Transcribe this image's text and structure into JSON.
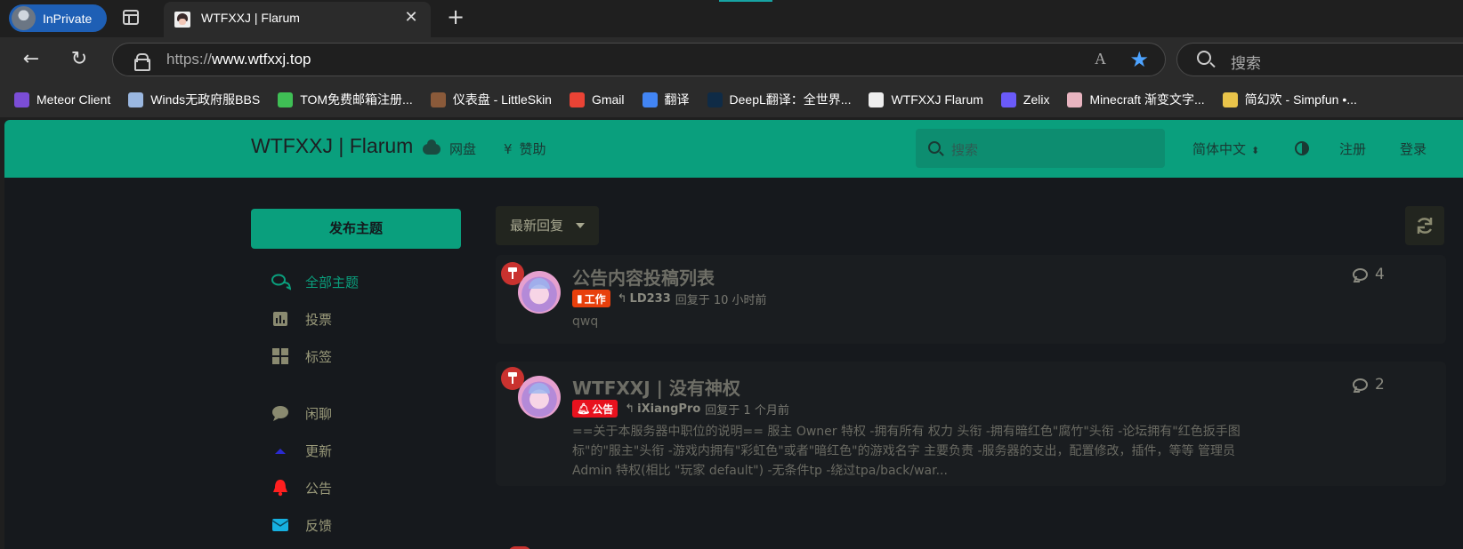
{
  "browser": {
    "inprivate_label": "InPrivate",
    "tab_title": "WTFXXJ | Flarum",
    "tab_close": "✕",
    "new_tab": "+",
    "url_prefix": "https://",
    "url_host": "www.wtfxxj.top",
    "search_placeholder": "搜索",
    "read_aloud": "A",
    "favorite_star": "★"
  },
  "bookmarks": [
    {
      "label": "Meteor Client",
      "icon": "meteor-icon",
      "color": "#7b4dd6"
    },
    {
      "label": "Winds无政府服BBS",
      "icon": "winds-icon",
      "color": "#9ab7e0"
    },
    {
      "label": "TOM免费邮箱注册...",
      "icon": "tom-icon",
      "color": "#3fbf55"
    },
    {
      "label": "仪表盘 - LittleSkin",
      "icon": "littleskin-icon",
      "color": "#8a5a3a"
    },
    {
      "label": "Gmail",
      "icon": "gmail-icon",
      "color": "#ea4335"
    },
    {
      "label": "翻译",
      "icon": "translate-icon",
      "color": "#4285f4"
    },
    {
      "label": "DeepL翻译：全世界...",
      "icon": "deepl-icon",
      "color": "#0f2b46"
    },
    {
      "label": "WTFXXJ Flarum",
      "icon": "wtfxxj-icon",
      "color": "#eeeeee"
    },
    {
      "label": "Zelix",
      "icon": "zelix-icon",
      "color": "#6a5af9"
    },
    {
      "label": "Minecraft 渐变文字...",
      "icon": "palette-icon",
      "color": "#e8b4c0"
    },
    {
      "label": "简幻欢 - Simpfun •...",
      "icon": "simpfun-icon",
      "color": "#e9c44a"
    }
  ],
  "site": {
    "brand": "WTFXXJ | Flarum",
    "nav_links": [
      {
        "label": "网盘",
        "icon": "cloud-icon"
      },
      {
        "label": "赞助",
        "icon": "yen-icon",
        "glyph": "¥"
      }
    ],
    "search_placeholder": "搜索",
    "language": "简体中文",
    "signup": "注册",
    "login": "登录",
    "accent_color": "#0a9f7d"
  },
  "sidebar": {
    "compose_label": "发布主题",
    "items": [
      {
        "label": "全部主题",
        "icon": "comments-icon",
        "active": true
      },
      {
        "label": "投票",
        "icon": "poll-icon"
      },
      {
        "label": "标签",
        "icon": "tags-grid-icon"
      },
      {
        "label": "闲聊",
        "icon": "chat-bubble-icon"
      },
      {
        "label": "更新",
        "icon": "arrow-up-icon"
      },
      {
        "label": "公告",
        "icon": "bell-icon"
      },
      {
        "label": "反馈",
        "icon": "envelope-icon"
      }
    ]
  },
  "toolbar": {
    "sort_label": "最新回复",
    "refresh_icon": "refresh-icon"
  },
  "discussions": [
    {
      "title": "公告内容投稿列表",
      "tag": "工作",
      "tag_color": "#e8400c",
      "user": "LD233",
      "meta": "回复于 10 小时前",
      "excerpt": "qwq",
      "reply_count": "4"
    },
    {
      "title": "WTFXXJ | 没有神权",
      "tag": "公告",
      "tag_color": "#e8121e",
      "user": "iXiangPro",
      "meta": "回复于 1 个月前",
      "excerpt": "==关于本服务器中职位的说明== 服主 Owner 特权 -拥有所有 权力 头衔 -拥有暗红色\"腐竹\"头衔 -论坛拥有\"红色扳手图标\"的\"服主\"头衔 -游戏内拥有\"彩虹色\"或者\"暗红色\"的游戏名字 主要负责 -服务器的支出，配置修改，插件，等等 管理员 Admin 特权(相比 \"玩家 default\") -无条件tp -绕过tpa/back/war...",
      "reply_count": "2"
    }
  ]
}
